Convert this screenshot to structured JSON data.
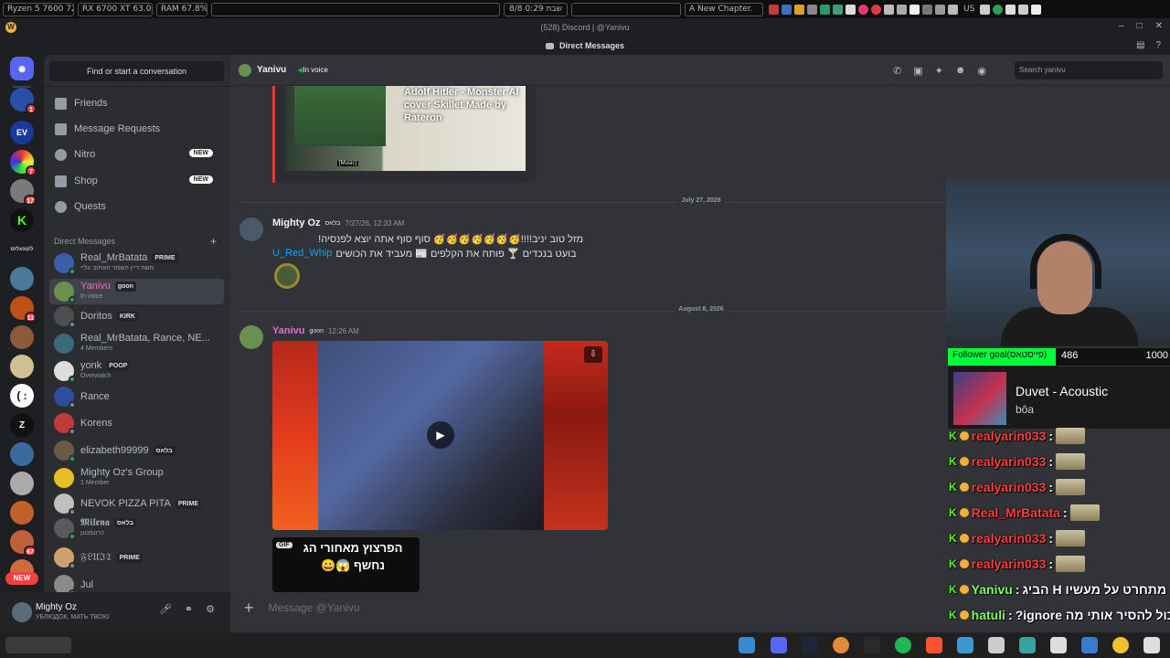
{
  "sysbar": {
    "cpu": "Ryzen 5 7600  72.9 °C",
    "gpu": "RX 6700 XT  63.0 °C",
    "ram": "RAM     67.8%",
    "date_clock": "8/8  שבת  0:29",
    "chapter": "A New Chapter.",
    "lang": "US"
  },
  "window": {
    "title": "(528) Discord | @Yanivu",
    "subtitle": "Direct Messages"
  },
  "sidebar": {
    "find_placeholder": "Find or start a conversation",
    "nav": [
      {
        "label": "Friends"
      },
      {
        "label": "Message Requests"
      },
      {
        "label": "Nitro",
        "tag": "NEW"
      },
      {
        "label": "Shop",
        "tag": "NEW"
      },
      {
        "label": "Quests"
      }
    ],
    "dm_header": "Direct Messages",
    "dms": [
      {
        "name": "Real_MrBatata",
        "tag": "PRIME",
        "sub": "משה דיין השמר האחוב עליי",
        "color": "#3a5fa8",
        "status": "#23a55a"
      },
      {
        "name": "Yanivu",
        "tag": "goon",
        "sub": "In voice",
        "color": "#6b8f4e",
        "status": "#23a55a",
        "active": true
      },
      {
        "name": "Doritos",
        "tag": "KIRK",
        "sub": "",
        "color": "#4e4e4e",
        "status": "#80848e"
      },
      {
        "name": "Real_MrBatata, Rance, NE...",
        "tag": "",
        "sub": "4 Members",
        "color": "#3a6b7a",
        "status": ""
      },
      {
        "name": "yonk",
        "tag": "POOP",
        "sub": "Overwatch",
        "color": "#dddddd",
        "status": "#23a55a"
      },
      {
        "name": "Rance",
        "tag": "",
        "sub": "",
        "color": "#2e4da0",
        "status": "#80848e"
      },
      {
        "name": "Korens",
        "tag": "",
        "sub": "",
        "color": "#c23a3a",
        "status": "#80848e"
      },
      {
        "name": "elizabeth99999",
        "tag": "בלאס",
        "sub": "",
        "color": "#6b5a4a",
        "status": "#23a55a"
      },
      {
        "name": "Mighty Oz's Group",
        "tag": "",
        "sub": "1 Member",
        "color": "#e6c020",
        "status": ""
      },
      {
        "name": "NEVOK PIZZA PITA",
        "tag": "PRIME",
        "sub": "",
        "color": "#c0c0c0",
        "status": "#80848e"
      },
      {
        "name": "𝕸𝖎𝖑𝖊𝖓𝖆",
        "tag": "בלאס",
        "sub": "כרונמטנן",
        "color": "#5a5a5a",
        "status": "#23a55a"
      },
      {
        "name": "𝔉𝔏𝔘ℑ𝔗",
        "tag": "PRIME",
        "sub": "",
        "color": "#d0a070",
        "status": "#80848e"
      },
      {
        "name": "Jul",
        "tag": "",
        "sub": "",
        "color": "#8a8a8a",
        "status": "#80848e"
      }
    ]
  },
  "user_panel": {
    "name": "Mighty Oz",
    "status": "УБЛЮДОК, МАТЬ ТВОЮ"
  },
  "rail": {
    "badges": [
      "1",
      "7",
      "17",
      "11",
      "2",
      "67"
    ],
    "new_label": "NEW"
  },
  "chat": {
    "recipient": "Yanivu",
    "recipient_status": "In voice",
    "search_placeholder": "Search yanivu",
    "embed": {
      "title": "Adolf Hitler - Monster AI cover Skillet Made by Rateron",
      "caption": "[Music]"
    },
    "date1": "July 27, 2026",
    "msg1": {
      "author": "Mighty Oz",
      "tag": "בלאס",
      "time": "7/27/26, 12:33 AM",
      "line1": "מזל טוב יניב!!!!🥳🥳🥳🥳🥳🥳🥳 סוף סוף אתה יוצא לפנסיה!",
      "line2": "בועט בנכדים 🍸 פותח את הקלפים 📰 מעביד את הכושים",
      "mention": "U_Red_Whip"
    },
    "date2": "August 8, 2026",
    "msg2": {
      "author": "Yanivu",
      "tag": "goon",
      "time": "12:26 AM",
      "gif_label": "GIF",
      "gif_text": "הפרצוץ מאחורי הג נחשף 😱😀"
    },
    "composer_placeholder": "Message @Yanivu"
  },
  "overlay": {
    "goal_label": "Follower goal(פייסטאס)",
    "goal_value": "486",
    "goal_max": "1000",
    "goal_fraction": 0.486,
    "now_playing_title": "Duvet - Acoustic",
    "now_playing_artist": "bôa",
    "stream_chat": [
      {
        "user": "realyarin033",
        "color": "#ff3c3c",
        "text": ""
      },
      {
        "user": "realyarin033",
        "color": "#ff3c3c",
        "text": ""
      },
      {
        "user": "realyarin033",
        "color": "#ff3c3c",
        "text": ""
      },
      {
        "user": "Real_MrBatata",
        "color": "#ff3c3c",
        "text": ""
      },
      {
        "user": "realyarin033",
        "color": "#ff3c3c",
        "text": ""
      },
      {
        "user": "realyarin033",
        "color": "#ff3c3c",
        "text": ""
      },
      {
        "user": "Yanivu",
        "color": "#7fff5e",
        "text": "מתחרט על מעשיו H הביג"
      },
      {
        "user": "hatuli",
        "color": "#7fff5e",
        "text": "אתה יכול להסיר אותי מה ignore?"
      }
    ]
  }
}
